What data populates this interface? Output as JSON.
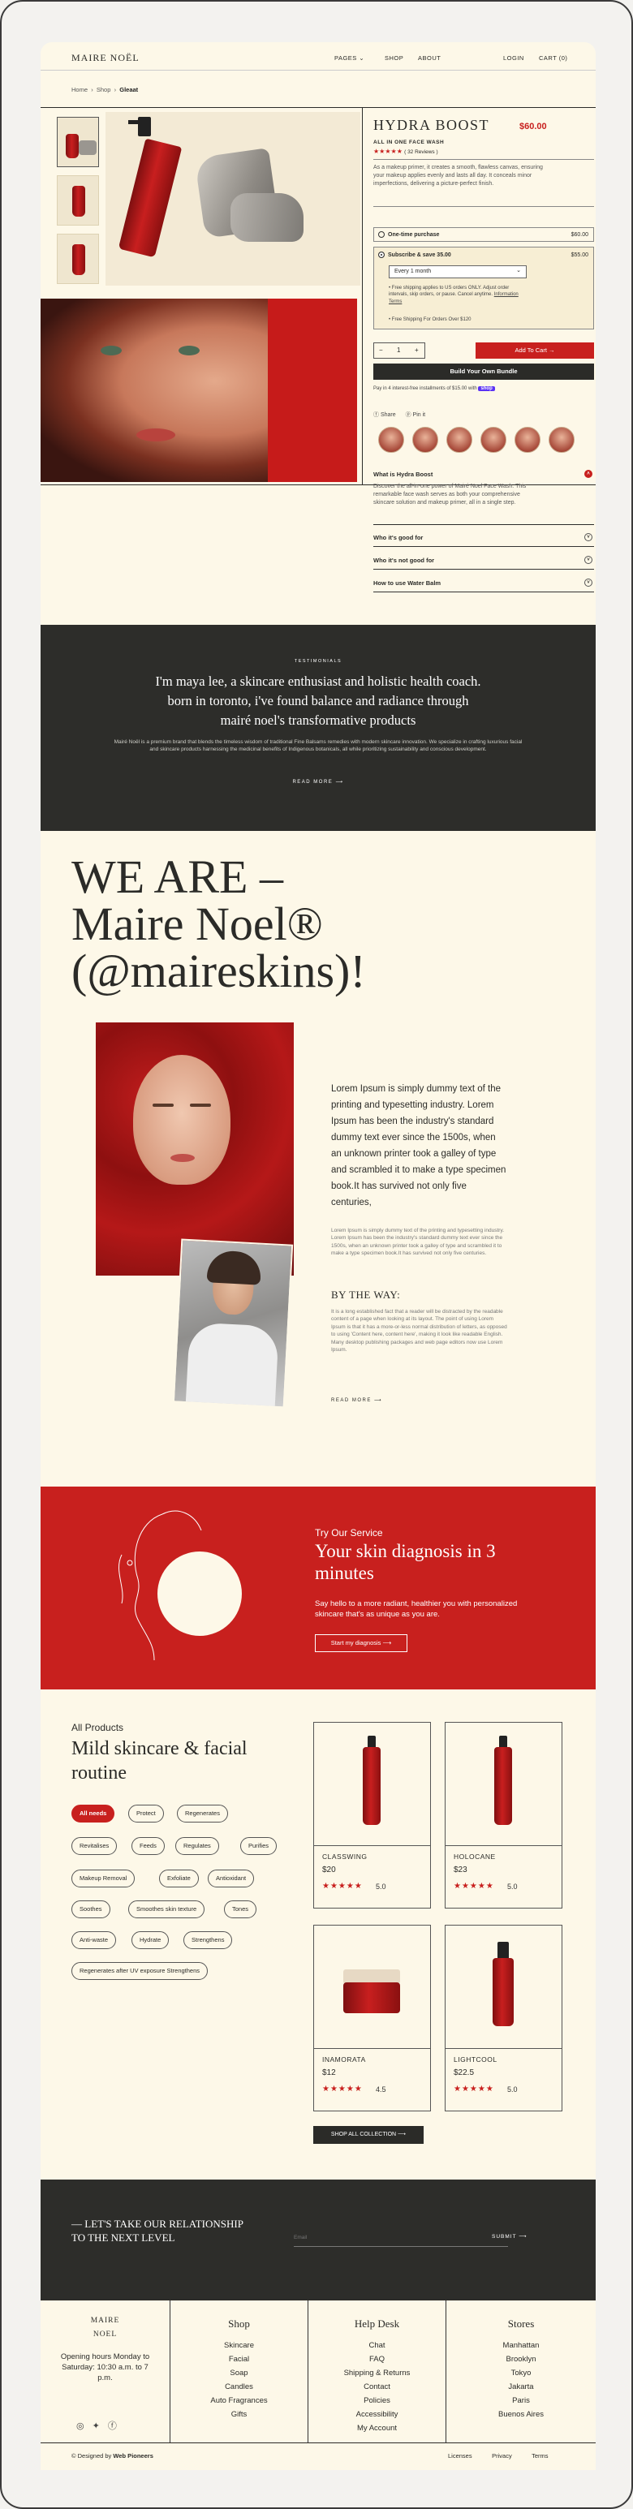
{
  "nav": {
    "logo": "MAIRE NOËL",
    "links": [
      "PAGES",
      "SHOP",
      "ABOUT"
    ],
    "login": "LOGIN",
    "cart": "CART (0)"
  },
  "breadcrumb": {
    "home": "Home",
    "shop": "Shop",
    "current": "Gleaat"
  },
  "product": {
    "name": "HYDRA BOOST",
    "price": "$60.00",
    "subtitle": "ALL IN ONE FACE WASH",
    "stars": "★★★★★",
    "reviews": "( 32 Reviews )",
    "description": "As a makeup primer, it creates a smooth, flawless canvas, ensuring your makeup applies evenly and lasts all day. It conceals minor imperfections, delivering a picture-perfect finish.",
    "one_time_label": "One-time purchase",
    "one_time_price": "$60.00",
    "subscribe_label": "Subscribe & save 35.00",
    "subscribe_price": "$55.00",
    "frequency": "Every 1 month",
    "benefit1": "Free shipping applies to US orders ONLY. Adjust order intervals, skip orders, or pause. Cancel anytime.",
    "benefit1_link": "Information Terms",
    "benefit2": "Free Shipping For Orders Over $120",
    "qty": "1",
    "qty_minus": "−",
    "qty_plus": "+",
    "add_to_cart": "Add To Cart",
    "bundle": "Build Your Own Bundle",
    "pay_note": "Pay in 4 interest-free installments of $15.00 with",
    "pay_brand": "shop",
    "share": "Share",
    "pin": "Pin it",
    "acc": [
      "What is Hydra Boost",
      "Who it's good for",
      "Who it's not good for",
      "How to use Water Balm"
    ],
    "acc_body": "Discover the all-in-one power of Mairé Noel Face Wash. This remarkable face wash serves as both your comprehensive skincare solution and makeup primer, all in a single step."
  },
  "testimonial": {
    "label": "TESTIMONIALS",
    "quote": "I'm maya lee, a skincare enthusiast and holistic health coach. born in toronto, i've found balance and radiance through mairé noel's transformative products",
    "body": "Mairé Noël is a premium brand that blends the timeless wisdom of traditional Fine Balsams remedies with modern skincare innovation. We specialize in crafting luxurious facial and skincare products harnessing the medicinal benefits of Indigenous botanicals, all while prioritizing sustainability and conscious development.",
    "more": "READ MORE"
  },
  "about": {
    "title1": "WE ARE –",
    "title2": "Maire Noel®",
    "title3": "(@maireskins)!",
    "lead": "Lorem Ipsum is simply dummy text of the printing and typesetting industry. Lorem Ipsum has been the industry's standard dummy text ever since the 1500s, when an unknown printer took a galley of type and scrambled it to make a type specimen book.It has survived not only five centuries,",
    "para": "Lorem Ipsum is simply dummy text of the printing and typesetting industry. Lorem Ipsum has been the industry's standard dummy text ever since the 1500s, when an unknown printer took a galley of type and scrambled it to make a type specimen book.It has survived not only five centuries.",
    "by_the_way": "BY THE WAY:",
    "para2": "It is a long established fact that a reader will be distracted by the readable content of a page when looking at its layout. The point of using Lorem Ipsum is that it has a more-or-less normal distribution of letters, as opposed to using 'Content here, content here', making it look like readable English. Many desktop publishing packages and web page editors now use Lorem Ipsum.",
    "more": "READ MORE"
  },
  "diagnosis": {
    "kicker": "Try Our Service",
    "title": "Your skin diagnosis in 3 minutes",
    "body": "Say hello to a more radiant, healthier you with personalized skincare that's as unique as you are.",
    "cta": "Start my diagnosis"
  },
  "products": {
    "kicker": "All Products",
    "title": "Mild skincare & facial routine",
    "chips": [
      "All needs",
      "Protect",
      "Regenerates",
      "Revitalises",
      "Feeds",
      "Regulates",
      "Purifies",
      "Makeup Removal",
      "Exfoliate",
      "Antioxidant",
      "Soothes",
      "Smoothes skin texture",
      "Tones",
      "Anti-waste",
      "Hydrate",
      "Strengthens",
      "Regenerates after UV exposure Strengthens"
    ],
    "items": [
      {
        "name": "CLASSWING",
        "price": "$20",
        "stars": "★★★★★",
        "rating": "5.0"
      },
      {
        "name": "HOLOCANE",
        "price": "$23",
        "stars": "★★★★★",
        "rating": "5.0"
      },
      {
        "name": "INAMORATA",
        "price": "$12",
        "stars": "★★★★★",
        "rating": "4.5"
      },
      {
        "name": "LIGHTCOOL",
        "price": "$22.5",
        "stars": "★★★★★",
        "rating": "5.0"
      }
    ],
    "cta": "SHOP ALL COLLECTION"
  },
  "newsletter": {
    "title": "— LET'S TAKE OUR RELATIONSHIP TO THE NEXT LEVEL",
    "placeholder": "Email",
    "submit": "SUBMIT"
  },
  "footer": {
    "logo1": "MAIRE",
    "logo2": "NOEL",
    "hours": "Opening hours Monday to Saturday: 10:30 a.m. to 7 p.m.",
    "shop_title": "Shop",
    "shop": [
      "Skincare",
      "Facial",
      "Soap",
      "Candles",
      "Auto Fragrances",
      "Gifts"
    ],
    "help_title": "Help Desk",
    "help": [
      "Chat",
      "FAQ",
      "Shipping & Returns",
      "Contact",
      "Policies",
      "Accessibility",
      "My Account"
    ],
    "stores_title": "Stores",
    "stores": [
      "Manhattan",
      "Brooklyn",
      "Tokyo",
      "Jakarta",
      "Paris",
      "Buenos Aires"
    ],
    "credit_pre": "© Designed by",
    "credit": "Web Pioneers",
    "legal": [
      "Licenses",
      "Privacy",
      "Terms"
    ]
  },
  "colors": {
    "accent": "#c8201e",
    "dark": "#2d2d2a",
    "cream": "#fdf8e8"
  }
}
